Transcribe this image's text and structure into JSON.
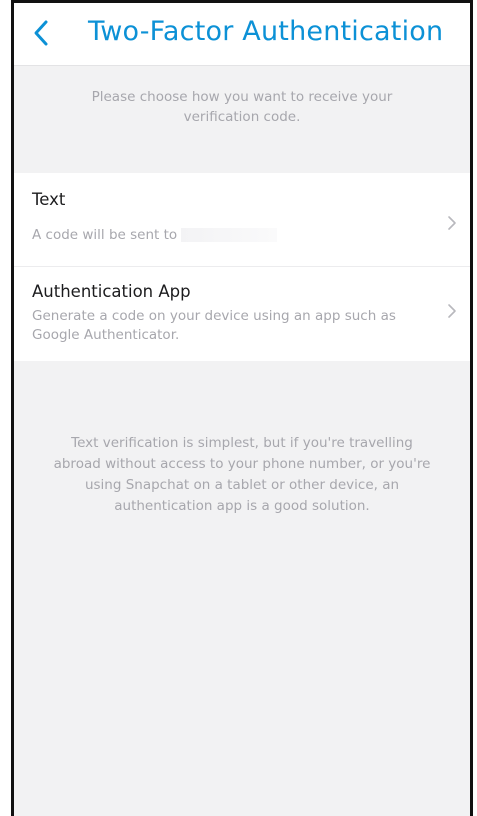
{
  "header": {
    "title": "Two-Factor Authentication",
    "back_icon": "chevron-left-icon",
    "accent_color": "#0c91d6"
  },
  "intro": {
    "line1": "Please choose how you want to receive your",
    "line2": "verification code."
  },
  "options": [
    {
      "title": "Text",
      "desc_prefix": "A code will be sent to",
      "icon": "chevron-right-icon"
    },
    {
      "title": "Authentication App",
      "desc": "Generate a code on your device using an app such as Google Authenticator.",
      "icon": "chevron-right-icon"
    }
  ],
  "footer_note": {
    "line1": "Text verification is simplest, but if you're travelling",
    "line2": "abroad without access to your phone number, or you're",
    "line3": "using Snapchat on a tablet or other device, an",
    "line4": "authentication app is a good solution."
  }
}
